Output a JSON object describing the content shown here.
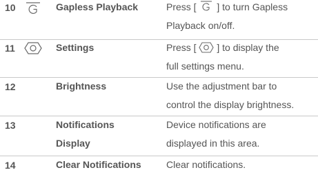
{
  "rows": [
    {
      "number": "10",
      "icon": "gapless-g-icon",
      "name": "Gapless Playback",
      "desc_pre": "Press [",
      "desc_post": "] to turn Gapless",
      "desc_line2": "Playback on/off."
    },
    {
      "number": "11",
      "icon": "settings-gear-icon",
      "name": "Settings",
      "desc_pre": "Press [",
      "desc_post": "] to display the",
      "desc_line2": "full settings menu."
    },
    {
      "number": "12",
      "name": "Brightness",
      "desc_line1": "Use the adjustment bar to",
      "desc_line2": "control the display brightness."
    },
    {
      "number": "13",
      "name_line1": "Notifications",
      "name_line2": "Display",
      "desc_line1": "Device notifications are",
      "desc_line2": "displayed in this area."
    },
    {
      "number": "14",
      "name": "Clear Notifications",
      "desc_line1": "Clear notifications."
    }
  ],
  "colors": {
    "text": "#555555",
    "divider": "#c8c8c8"
  }
}
